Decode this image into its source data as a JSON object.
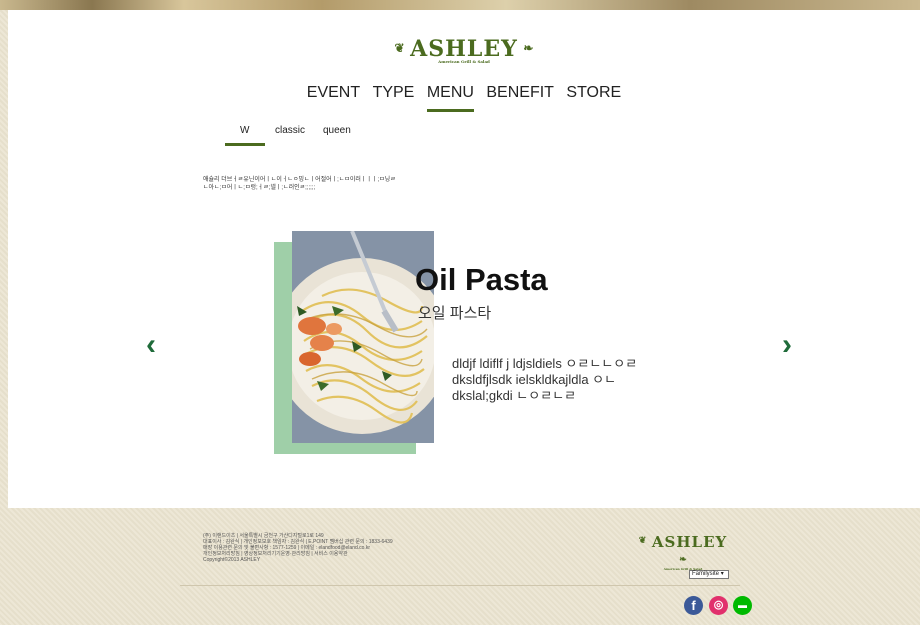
{
  "brand": {
    "logo": "ASHLEY",
    "tagline": "American Grill & Salad"
  },
  "nav": {
    "items": [
      "EVENT",
      "TYPE",
      "MENU",
      "BENEFIT",
      "STORE"
    ],
    "active": "MENU"
  },
  "subtabs": {
    "items": [
      "W",
      "classic",
      "queen"
    ],
    "active": "W"
  },
  "description": {
    "line1": "애슐리 더브ㅓㄹ유닌이어ㅣㄴ이ㅓㄴㅇ밍ㄴㅣ어절어ㅣ;ㄴㅁ이러ㅣㅣㅣ;ㅁ닝ㄹ",
    "line2": "ㄴ아ㄴ;ㅁ어ㅣㄴ;ㅁ렁;ㅓㄹ;넬ㅣ;ㄴ러인ㄹ;;;;;;"
  },
  "dish": {
    "title": "Oil Pasta",
    "title_kr": "오일 파스타",
    "desc": [
      "dldjf ldiflf j ldjsldiels ㅇㄹㄴㄴㅇㄹ",
      "dksldfjlsdk  ielskldkajldla ㅇㄴ",
      "dkslal;gkdi ㄴㅇㄹㄴㄹ"
    ]
  },
  "carousel": {
    "prev_icon": "‹",
    "next_icon": "›"
  },
  "footer": {
    "lines": [
      "(주) 이랜드이츠 | 서울특별시 금천구 가산디지털로1로 149",
      "대표이사 : 김완식 | 개인정보보호 책임자 : 김완식 | E.POINT 멤버십 관련 문의 : 1833-6439",
      "매장 이용관련 문의 및 불편사항 : 1577-1259 | 이메일 : elandfood@eland.co.kr",
      "개인정보처리방침 | 영상정보처리기기운영·관리방침 | 서비스 이용약관",
      "Copyright©2013 ASHLEY"
    ],
    "familysite": "Familysite"
  },
  "colors": {
    "accent": "#4b6b1f",
    "arrow": "#1f6b3a",
    "photo_frame": "#9fcfa8",
    "facebook": "#3b5998",
    "instagram": "#e1306c",
    "line": "#00b900"
  }
}
